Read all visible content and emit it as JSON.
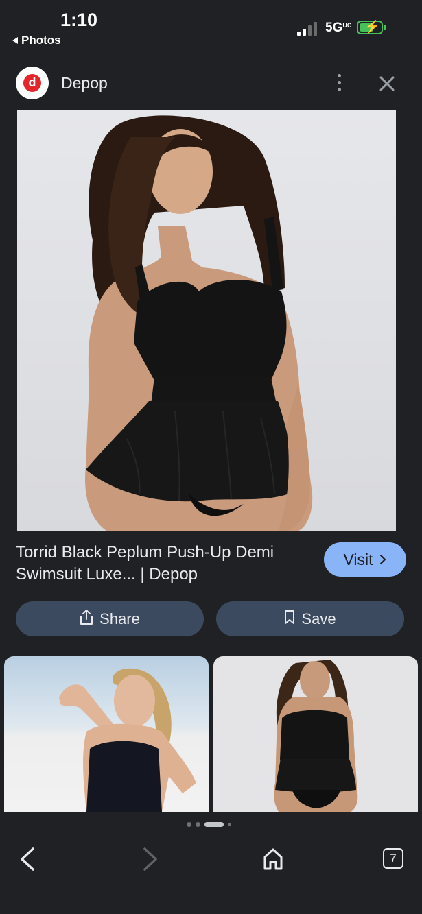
{
  "status_bar": {
    "time": "1:10",
    "back_app": "Photos",
    "network": "5G",
    "network_suffix": "UC"
  },
  "header": {
    "logo_letter": "d",
    "site_name": "Depop"
  },
  "result": {
    "title": "Torrid Black Peplum Push-Up Demi Swimsuit Luxe... | Depop",
    "visit_label": "Visit",
    "share_label": "Share",
    "save_label": "Save"
  },
  "tab_count": "7",
  "colors": {
    "accent": "#8ab4f8",
    "logo_red": "#e3262b",
    "pill_bg": "#3c4a5f",
    "background": "#202124",
    "battery": "#45c35a"
  }
}
